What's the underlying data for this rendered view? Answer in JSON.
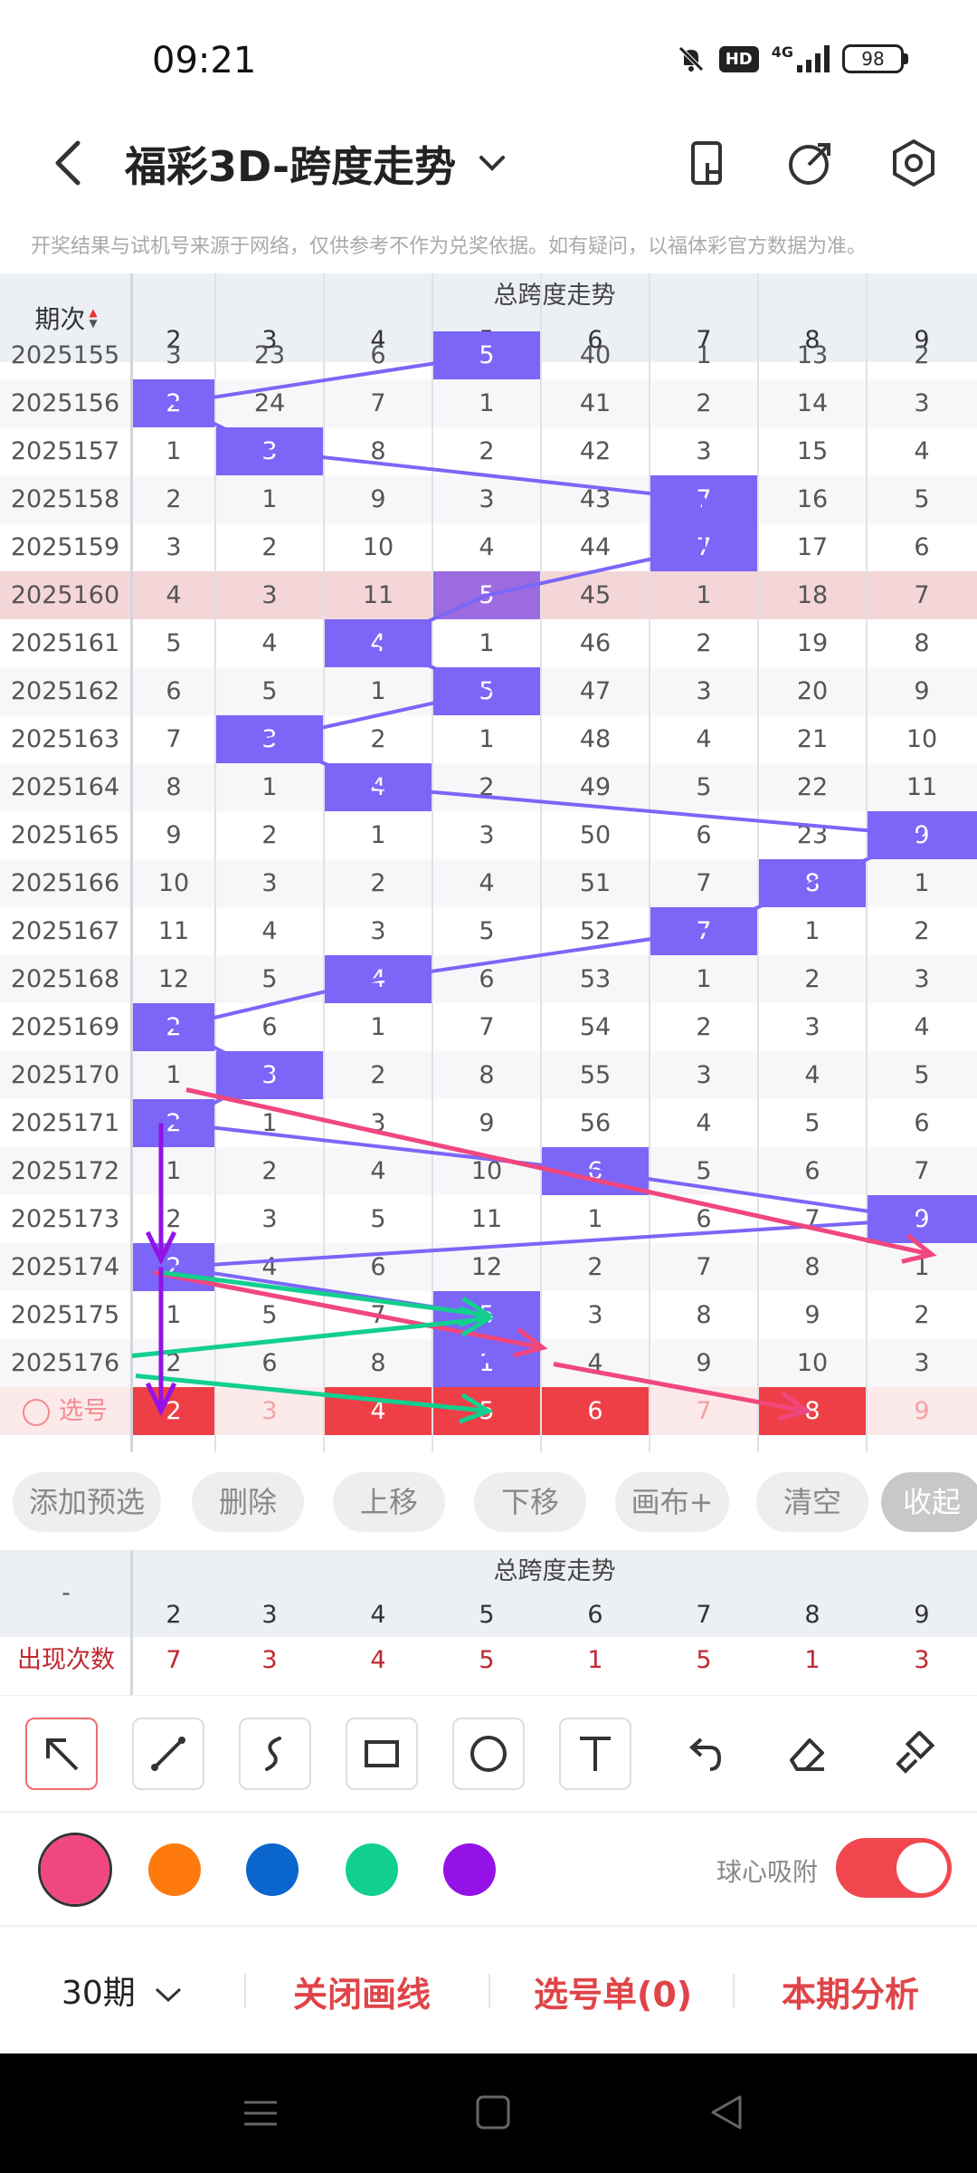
{
  "status_bar": {
    "time": "09:21",
    "battery": "98",
    "hd": "HD",
    "network": "4G"
  },
  "header": {
    "title": "福彩3D-跨度走势"
  },
  "notice": "开奖结果与试机号来源于网络，仅供参考不作为兑奖依据。如有疑问，以福体彩官方数据为准。",
  "table": {
    "period_header": "期次",
    "group_header": "总跨度走势",
    "columns": [
      "2",
      "3",
      "4",
      "5",
      "6",
      "7",
      "8",
      "9"
    ],
    "rows": [
      {
        "period": "2025155",
        "values": [
          "3",
          "23",
          "6",
          "5",
          "40",
          "1",
          "13",
          "2"
        ],
        "hit": 3
      },
      {
        "period": "2025156",
        "values": [
          "2",
          "24",
          "7",
          "1",
          "41",
          "2",
          "14",
          "3"
        ],
        "hit": 0
      },
      {
        "period": "2025157",
        "values": [
          "1",
          "3",
          "8",
          "2",
          "42",
          "3",
          "15",
          "4"
        ],
        "hit": 1
      },
      {
        "period": "2025158",
        "values": [
          "2",
          "1",
          "9",
          "3",
          "43",
          "7",
          "16",
          "5"
        ],
        "hit": 5
      },
      {
        "period": "2025159",
        "values": [
          "3",
          "2",
          "10",
          "4",
          "44",
          "7",
          "17",
          "6"
        ],
        "hit": 5
      },
      {
        "period": "2025160",
        "values": [
          "4",
          "3",
          "11",
          "5",
          "45",
          "1",
          "18",
          "7"
        ],
        "hit": 3
      },
      {
        "period": "2025161",
        "values": [
          "5",
          "4",
          "4",
          "1",
          "46",
          "2",
          "19",
          "8"
        ],
        "hit": 2
      },
      {
        "period": "2025162",
        "values": [
          "6",
          "5",
          "1",
          "5",
          "47",
          "3",
          "20",
          "9"
        ],
        "hit": 3
      },
      {
        "period": "2025163",
        "values": [
          "7",
          "3",
          "2",
          "1",
          "48",
          "4",
          "21",
          "10"
        ],
        "hit": 1
      },
      {
        "period": "2025164",
        "values": [
          "8",
          "1",
          "4",
          "2",
          "49",
          "5",
          "22",
          "11"
        ],
        "hit": 2
      },
      {
        "period": "2025165",
        "values": [
          "9",
          "2",
          "1",
          "3",
          "50",
          "6",
          "23",
          "9"
        ],
        "hit": 7
      },
      {
        "period": "2025166",
        "values": [
          "10",
          "3",
          "2",
          "4",
          "51",
          "7",
          "8",
          "1"
        ],
        "hit": 6
      },
      {
        "period": "2025167",
        "values": [
          "11",
          "4",
          "3",
          "5",
          "52",
          "7",
          "1",
          "2"
        ],
        "hit": 5
      },
      {
        "period": "2025168",
        "values": [
          "12",
          "5",
          "4",
          "6",
          "53",
          "1",
          "2",
          "3"
        ],
        "hit": 2
      },
      {
        "period": "2025169",
        "values": [
          "2",
          "6",
          "1",
          "7",
          "54",
          "2",
          "3",
          "4"
        ],
        "hit": 0
      },
      {
        "period": "2025170",
        "values": [
          "1",
          "3",
          "2",
          "8",
          "55",
          "3",
          "4",
          "5"
        ],
        "hit": 1
      },
      {
        "period": "2025171",
        "values": [
          "2",
          "1",
          "3",
          "9",
          "56",
          "4",
          "5",
          "6"
        ],
        "hit": 0
      },
      {
        "period": "2025172",
        "values": [
          "1",
          "2",
          "4",
          "10",
          "6",
          "5",
          "6",
          "7"
        ],
        "hit": 4
      },
      {
        "period": "2025173",
        "values": [
          "2",
          "3",
          "5",
          "11",
          "1",
          "6",
          "7",
          "9"
        ],
        "hit": 7
      },
      {
        "period": "2025174",
        "values": [
          "2",
          "4",
          "6",
          "12",
          "2",
          "7",
          "8",
          "1"
        ],
        "hit": 0
      },
      {
        "period": "2025175",
        "values": [
          "1",
          "5",
          "7",
          "5",
          "3",
          "8",
          "9",
          "2"
        ],
        "hit": 3
      },
      {
        "period": "2025176",
        "values": [
          "2",
          "6",
          "8",
          "1",
          "4",
          "9",
          "10",
          "3"
        ],
        "hit": 3
      }
    ],
    "pick_row": {
      "label": "选号",
      "values": [
        "2",
        "3",
        "4",
        "5",
        "6",
        "7",
        "8",
        "9"
      ],
      "selected": [
        0,
        2,
        3,
        4,
        6
      ]
    }
  },
  "actions": [
    "添加预选",
    "删除",
    "上移",
    "下移",
    "画布+",
    "清空",
    "收起"
  ],
  "stats": {
    "left_header": "-",
    "group_header": "总跨度走势",
    "columns": [
      "2",
      "3",
      "4",
      "5",
      "6",
      "7",
      "8",
      "9"
    ],
    "label": "出现次数",
    "values": [
      "7",
      "3",
      "4",
      "5",
      "1",
      "5",
      "1",
      "3"
    ]
  },
  "tools": [
    "arrow-tool",
    "line-tool",
    "curve-tool",
    "rectangle-tool",
    "circle-tool",
    "text-tool",
    "undo-tool",
    "eraser-tool",
    "clear-tool"
  ],
  "colors": [
    "#f0477f",
    "#ff7a0d",
    "#0a66cc",
    "#12cf8f",
    "#9412e6"
  ],
  "snap": {
    "label": "球心吸附",
    "on": true
  },
  "bottom": {
    "periods": "30期",
    "close_lines": "关闭画线",
    "ticket": "选号单(0)",
    "analysis": "本期分析"
  }
}
